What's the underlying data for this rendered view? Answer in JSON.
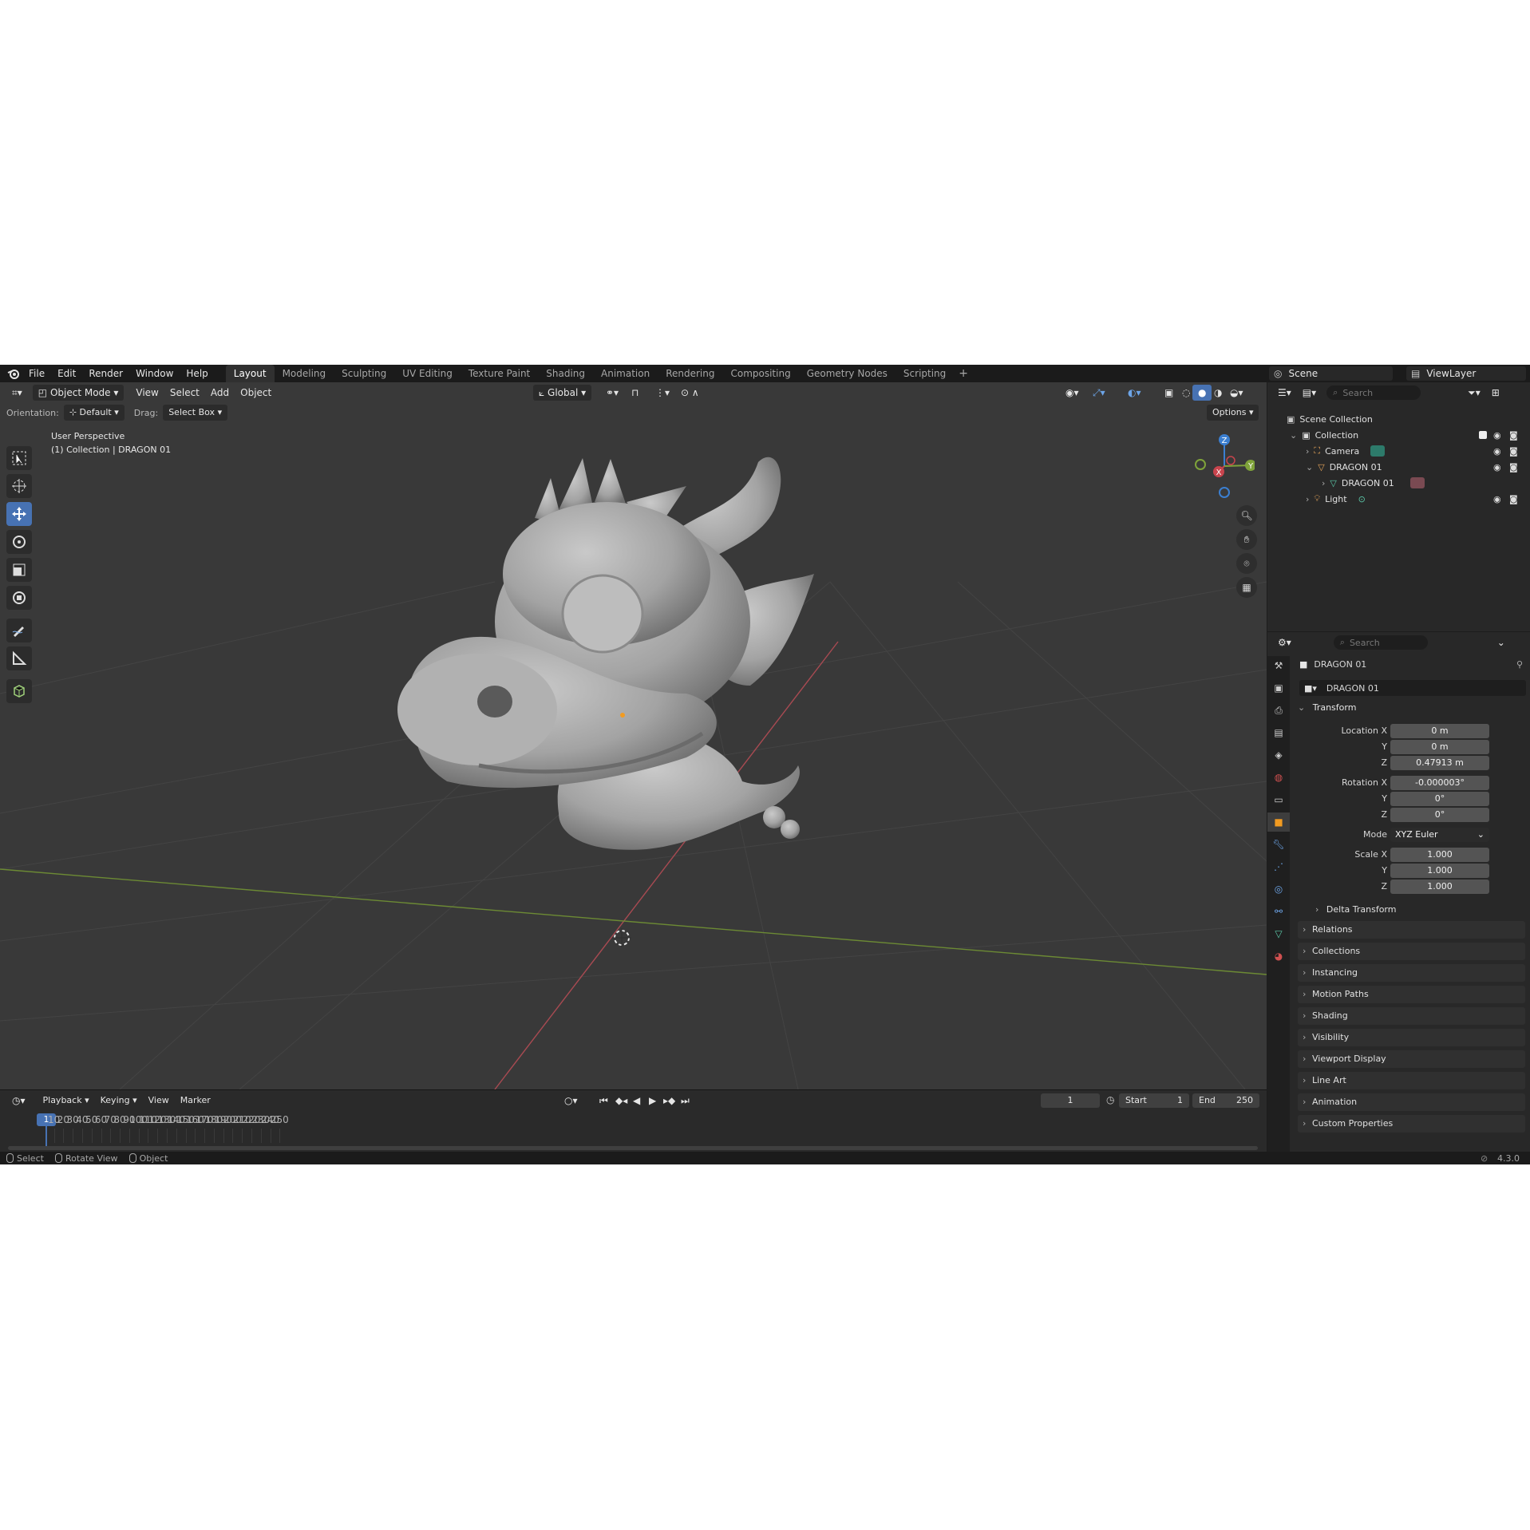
{
  "menubar": {
    "items": [
      "File",
      "Edit",
      "Render",
      "Window",
      "Help"
    ],
    "workspaces": [
      "Layout",
      "Modeling",
      "Sculpting",
      "UV Editing",
      "Texture Paint",
      "Shading",
      "Animation",
      "Rendering",
      "Compositing",
      "Geometry Nodes",
      "Scripting"
    ],
    "active_workspace": "Layout",
    "scene_label": "Scene",
    "view_layer_label": "ViewLayer"
  },
  "viewport": {
    "mode": "Object Mode",
    "menus": [
      "View",
      "Select",
      "Add",
      "Object"
    ],
    "transform_orientation": "Global",
    "orientation_label": "Orientation:",
    "orientation_value": "Default",
    "drag_label": "Drag:",
    "drag_value": "Select Box",
    "options_label": "Options",
    "overlay_line1": "User Perspective",
    "overlay_line2": "(1) Collection | DRAGON 01",
    "gizmo_axes": [
      "X",
      "Y",
      "Z"
    ]
  },
  "timeline": {
    "menus": [
      "Playback",
      "Keying",
      "View",
      "Marker"
    ],
    "current_frame": "1",
    "start_label": "Start",
    "start_value": "1",
    "end_label": "End",
    "end_value": "250",
    "ruler_ticks": [
      "10",
      "20",
      "30",
      "40",
      "50",
      "60",
      "70",
      "80",
      "90",
      "100",
      "110",
      "120",
      "130",
      "140",
      "150",
      "160",
      "170",
      "180",
      "190",
      "200",
      "210",
      "220",
      "230",
      "240",
      "250"
    ]
  },
  "statusbar": {
    "items": [
      "Select",
      "Rotate View",
      "Object"
    ],
    "version": "4.3.0"
  },
  "outliner": {
    "search_placeholder": "Search",
    "root": "Scene Collection",
    "collection": "Collection",
    "items": [
      "Camera",
      "DRAGON 01",
      "DRAGON 01",
      "Light"
    ]
  },
  "properties": {
    "search_placeholder": "Search",
    "object_name": "DRAGON 01",
    "object_field": "DRAGON 01",
    "transform_title": "Transform",
    "location_label": "Location X",
    "location": [
      "0 m",
      "0 m",
      "0.47913 m"
    ],
    "rotation_label": "Rotation X",
    "rotation": [
      "-0.000003°",
      "0°",
      "0°"
    ],
    "mode_label": "Mode",
    "mode_value": "XYZ Euler",
    "scale_label": "Scale X",
    "scale": [
      "1.000",
      "1.000",
      "1.000"
    ],
    "axis_y": "Y",
    "axis_z": "Z",
    "delta_transform": "Delta Transform",
    "panels": [
      "Relations",
      "Collections",
      "Instancing",
      "Motion Paths",
      "Shading",
      "Visibility",
      "Viewport Display",
      "Line Art",
      "Animation",
      "Custom Properties"
    ]
  },
  "colors": {
    "accent": "#4772b3",
    "x_axis": "#c8444d",
    "y_axis": "#7fa33a",
    "z_axis": "#3b7fd1",
    "viewport_bg": "#393939"
  }
}
